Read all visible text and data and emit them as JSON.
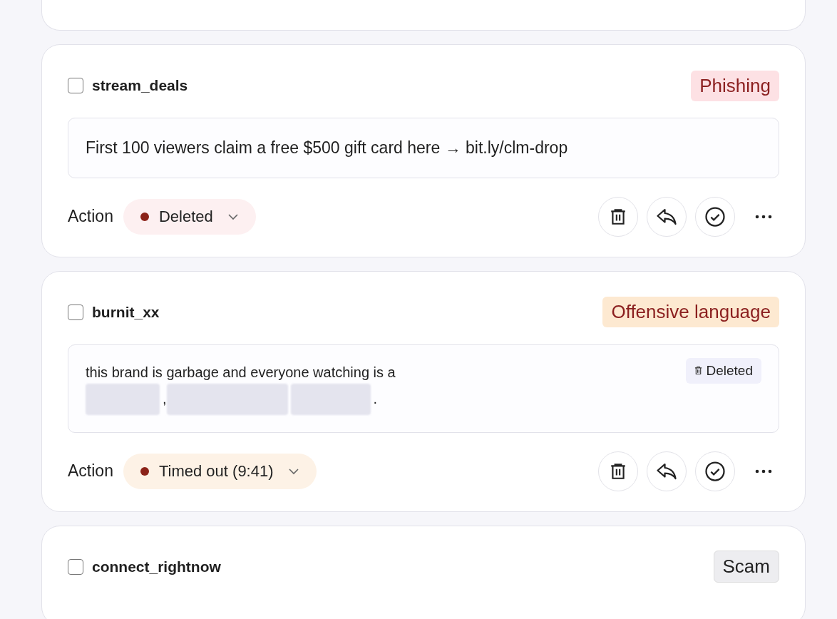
{
  "cards": [
    {
      "kind": "partial"
    },
    {
      "kind": "full",
      "username": "stream_deals",
      "checked": false,
      "tag": {
        "label": "Phishing",
        "color": "#fde1e4"
      },
      "message": {
        "segments": [
          {
            "kind": "text",
            "text": "First 100 viewers claim a free $500 gift card here → bit.ly/clm-drop"
          }
        ]
      },
      "action": {
        "label": "Action",
        "value": "Deleted",
        "color": "#fdf0f1"
      },
      "buttons": [
        {
          "kind": "delete"
        },
        {
          "kind": "reply"
        },
        {
          "kind": "approve"
        },
        {
          "kind": "more"
        }
      ]
    },
    {
      "kind": "full",
      "username": "burnit_xx",
      "checked": false,
      "tag": {
        "label": "Offensive language",
        "color": "#fde9d1"
      },
      "message": {
        "segments": [
          {
            "kind": "text",
            "text": "this brand is garbage and everyone watching is a"
          },
          {
            "kind": "redacted"
          },
          {
            "kind": "text",
            "text": ","
          },
          {
            "kind": "redacted"
          },
          {
            "kind": "redacted"
          },
          {
            "kind": "text",
            "text": "."
          }
        ],
        "badge": "Deleted"
      },
      "action": {
        "label": "Action",
        "value": "Timed out (9:41)",
        "color": "#fdf2e6"
      },
      "buttons": [
        {
          "kind": "delete"
        },
        {
          "kind": "reply"
        },
        {
          "kind": "approve"
        },
        {
          "kind": "more"
        }
      ]
    },
    {
      "kind": "cut",
      "username": "connect_rightnow",
      "checked": false,
      "tag": {
        "label": "Scam",
        "color": "#ededf0"
      }
    }
  ]
}
